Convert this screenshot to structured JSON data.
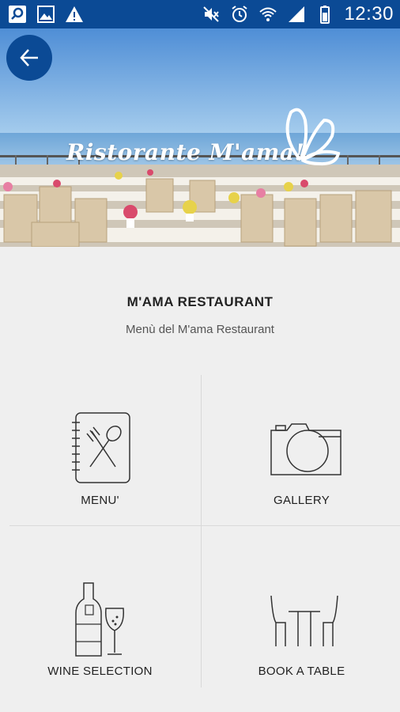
{
  "status_bar": {
    "time": "12:30",
    "icons_left": [
      "search-notification-icon",
      "image-notification-icon",
      "warning-icon"
    ],
    "icons_right": [
      "mute-icon",
      "alarm-icon",
      "wifi-icon",
      "signal-icon",
      "battery-icon"
    ]
  },
  "hero": {
    "title": "Ristorante M'ama!",
    "back_icon": "arrow-left-icon",
    "accent": "#0b4a95"
  },
  "info": {
    "title": "M'AMA RESTAURANT",
    "subtitle": "Menù del M'ama Restaurant"
  },
  "grid": {
    "items": [
      {
        "label": "MENU'",
        "icon": "menu-book-icon"
      },
      {
        "label": "GALLERY",
        "icon": "camera-icon"
      },
      {
        "label": "WINE SELECTION",
        "icon": "wine-icon"
      },
      {
        "label": "BOOK A TABLE",
        "icon": "table-icon"
      }
    ]
  }
}
